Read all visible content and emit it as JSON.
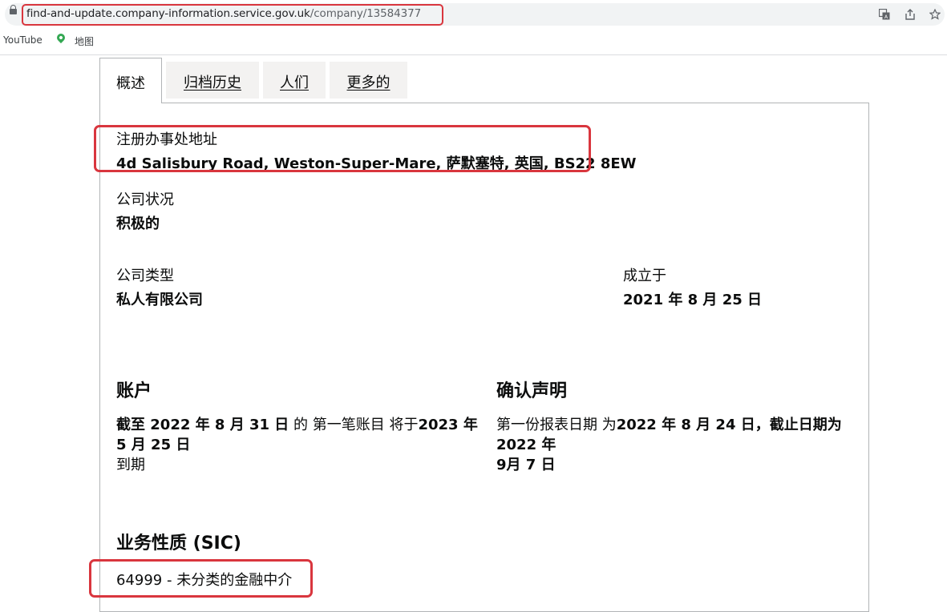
{
  "browser": {
    "url_host": "find-and-update.company-information.service.gov.uk",
    "url_path": "/company/13584377",
    "icons": [
      "lock-icon",
      "translate-icon",
      "share-icon",
      "star-icon"
    ],
    "bookmarks": [
      {
        "label": "YouTube"
      },
      {
        "label": "地图",
        "icon": "maps-pin-icon"
      }
    ]
  },
  "tabs": [
    {
      "label": "概述",
      "active": true
    },
    {
      "label": "归档历史",
      "active": false
    },
    {
      "label": "人们",
      "active": false
    },
    {
      "label": "更多的",
      "active": false
    }
  ],
  "overview": {
    "registered_office_label": "注册办事处地址",
    "registered_office_value": "4d Salisbury Road, Weston-Super-Mare, 萨默塞特, 英国, BS22 8EW",
    "status_label": "公司状况",
    "status_value": "积极的",
    "type_label": "公司类型",
    "type_value": "私人有限公司",
    "incorporated_label": "成立于",
    "incorporated_value": "2021 年 8 月 25 日"
  },
  "accounts": {
    "heading": "账户",
    "line1_bold_a": "截至 2022 年 8 月 31 日",
    "line1_plain": " 的 第一笔账目 将于",
    "line1_bold_b": "2023 年 5 月 25 日",
    "line2": "到期"
  },
  "confirmation": {
    "heading": "确认声明",
    "line1_plain": "第一份报表日期 为",
    "line1_bold": "2022 年 8 月 24 日，截止日期为 2022 年",
    "line2": "9月 7 日"
  },
  "sic": {
    "heading": "业务性质 (SIC)",
    "code": "64999",
    "separator": " - ",
    "description": "未分类的金融中介"
  },
  "highlight_color": "#d9363e"
}
